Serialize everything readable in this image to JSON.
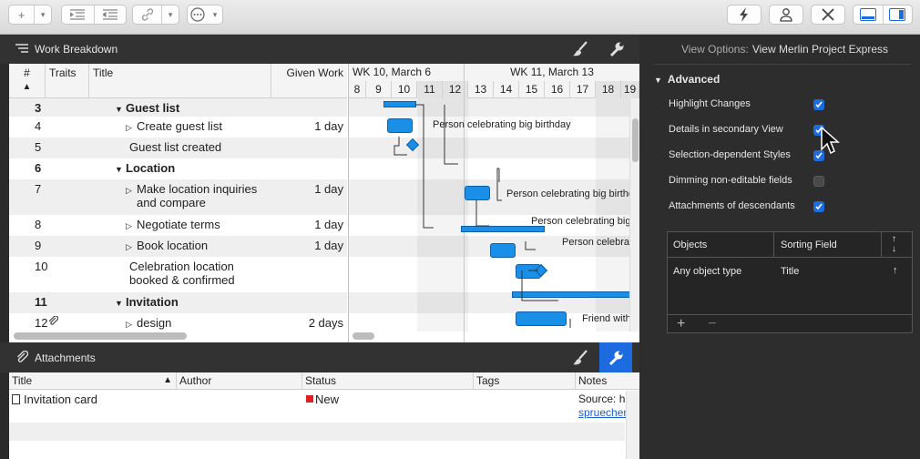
{
  "toolbar": {
    "buttons": [
      "add",
      "indent",
      "outdent",
      "link",
      "more",
      "flash",
      "person",
      "tools",
      "view-left",
      "view-right"
    ]
  },
  "work_breakdown": {
    "title": "Work Breakdown",
    "columns": {
      "num": "#",
      "traits": "Traits",
      "title": "Title",
      "given_work": "Given Work"
    },
    "weeks": [
      "WK 10, March 6",
      "WK 11, March 13"
    ],
    "days": [
      "8",
      "9",
      "10",
      "11",
      "12",
      "13",
      "14",
      "15",
      "16",
      "17",
      "18",
      "19"
    ],
    "rows": [
      {
        "num": "3",
        "title": "Guest list",
        "work": "",
        "group": true
      },
      {
        "num": "4",
        "title": "Create guest list",
        "work": "1 day",
        "group": false
      },
      {
        "num": "5",
        "title": "Guest list created",
        "work": "",
        "group": false
      },
      {
        "num": "6",
        "title": "Location",
        "work": "",
        "group": true
      },
      {
        "num": "7",
        "title": "Make location inquiries",
        "title2": "and compare",
        "work": "1 day",
        "group": false
      },
      {
        "num": "8",
        "title": "Negotiate terms",
        "work": "1 day",
        "group": false
      },
      {
        "num": "9",
        "title": "Book location",
        "work": "1 day",
        "group": false
      },
      {
        "num": "10",
        "title": "Celebration location",
        "title2": "booked & confirmed",
        "work": "",
        "group": false
      },
      {
        "num": "11",
        "title": "Invitation",
        "work": "",
        "group": true
      },
      {
        "num": "12",
        "title": "design",
        "work": "2 days",
        "group": false
      }
    ],
    "gantt_labels": [
      "Person celebrating big birthday",
      "Person celebrating big birthd",
      "Person celebrating big",
      "Person celebra",
      "Friend with"
    ]
  },
  "attachments": {
    "title": "Attachments",
    "columns": {
      "title": "Title",
      "author": "Author",
      "status": "Status",
      "tags": "Tags",
      "notes": "Notes"
    },
    "row": {
      "title": "Invitation card",
      "status": "New",
      "notes1": "Source: h",
      "notes2": "spruechen"
    }
  },
  "inspector": {
    "view_options_label": "View Options:",
    "view_options_value": "View Merlin Project Express",
    "section": "Advanced",
    "options": [
      {
        "label": "Highlight Changes",
        "checked": true
      },
      {
        "label": "Details in secondary View",
        "checked": true
      },
      {
        "label": "Selection-dependent Styles",
        "checked": true
      },
      {
        "label": "Dimming non-editable fields",
        "checked": false
      },
      {
        "label": "Attachments of descendants",
        "checked": true
      }
    ],
    "sort": {
      "col_objects": "Objects",
      "col_field": "Sorting Field",
      "row_object": "Any object type",
      "row_field": "Title"
    }
  },
  "colors": {
    "accent": "#1c6ce0",
    "bar": "#1a8fe8",
    "status_new": "#e02020"
  }
}
